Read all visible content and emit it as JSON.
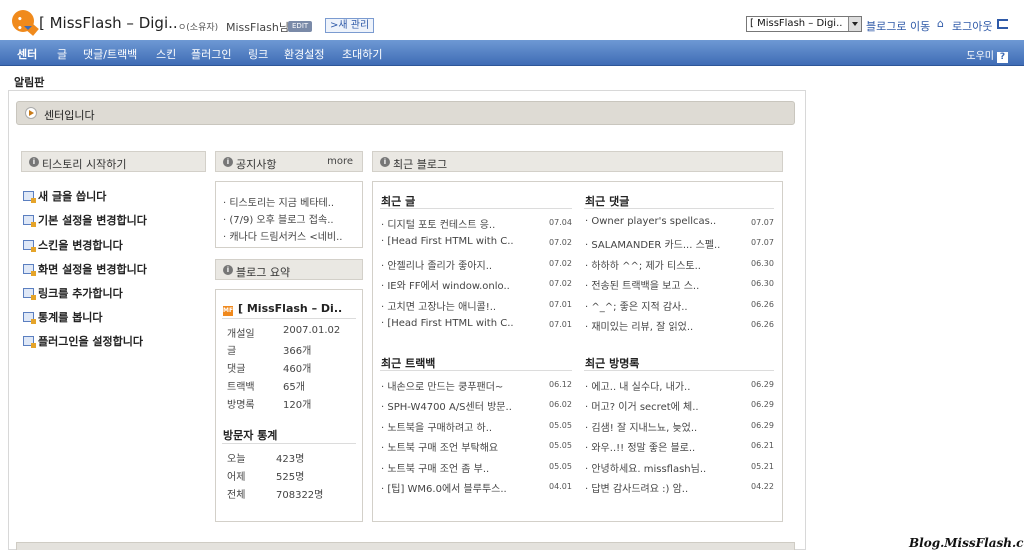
{
  "header": {
    "blog_title": "[ MissFlash – Digi..",
    "owner_label": "ㅇ(소유자)",
    "owner_name": "MissFlash님",
    "edit_badge": "EDIT",
    "new_admin": ">새 관리",
    "blog_select_value": "[ MissFlash – Digi..",
    "goto_blog": "블로그로 이동",
    "logout": "로그아웃"
  },
  "nav": {
    "items": [
      "센터",
      "글",
      "댓글/트랙백",
      "스킨",
      "플러그인",
      "링크",
      "환경설정",
      "초대하기"
    ],
    "help": "도우미"
  },
  "notice_label": "알림판",
  "center_message": "센터입니다",
  "start": {
    "title": "티스토리 시작하기",
    "items": [
      "새 글을 씁니다",
      "기본 설정을 변경합니다",
      "스킨을 변경합니다",
      "화면 설정을 변경합니다",
      "링크를 추가합니다",
      "통계를 봅니다",
      "플러그인을 설정합니다"
    ]
  },
  "notice": {
    "title": "공지사항",
    "more": "more",
    "items": [
      "티스토리는 지금 베타테..",
      "(7/9) 오후 블로그 접속..",
      "캐나다 드림서커스 <네비.."
    ]
  },
  "summary": {
    "title": "블로그 요약",
    "blog_name": "[ MissFlash – Di..",
    "rows": [
      {
        "label": "개설일",
        "value": "2007.01.02"
      },
      {
        "label": "글",
        "value": "366개"
      },
      {
        "label": "댓글",
        "value": "460개"
      },
      {
        "label": "트랙백",
        "value": "65개"
      },
      {
        "label": "방명록",
        "value": "120개"
      }
    ],
    "visitor_title": "방문자 통계",
    "visitor_rows": [
      {
        "label": "오늘",
        "value": "423명"
      },
      {
        "label": "어제",
        "value": "525명"
      },
      {
        "label": "전체",
        "value": "708322명"
      }
    ]
  },
  "recent": {
    "title": "최근 블로그",
    "posts": {
      "title": "최근 글",
      "items": [
        {
          "text": "디지털 포토 컨테스트 응..",
          "date": "07.04"
        },
        {
          "text": "[Head First HTML with C..",
          "date": "07.02"
        },
        {
          "text": "안젤리나 졸리가 좋아지..",
          "date": "07.02"
        },
        {
          "text": "IE와 FF에서 window.onlo..",
          "date": "07.02"
        },
        {
          "text": "고치면 고장나는 애니콜!..",
          "date": "07.01"
        },
        {
          "text": "[Head First HTML with C..",
          "date": "07.01"
        }
      ]
    },
    "comments": {
      "title": "최근 댓글",
      "items": [
        {
          "text": "Owner player's spellcas..",
          "date": "07.07"
        },
        {
          "text": "SALAMANDER 카드... 스펠..",
          "date": "07.07"
        },
        {
          "text": "하하하 ^^; 제가 티스토..",
          "date": "06.30"
        },
        {
          "text": "전송된 트랙백을 보고 스..",
          "date": "06.30"
        },
        {
          "text": "^_^; 좋은 지적 감사..",
          "date": "06.26"
        },
        {
          "text": "재미있는 리뷰, 잘 읽었..",
          "date": "06.26"
        }
      ]
    },
    "trackbacks": {
      "title": "최근 트랙백",
      "items": [
        {
          "text": "내손으로 만드는 쿵푸팬더~",
          "date": "06.12"
        },
        {
          "text": "SPH-W4700 A/S센터 방문..",
          "date": "06.02"
        },
        {
          "text": "노트북을 구매하려고 하..",
          "date": "05.05"
        },
        {
          "text": "노트북 구매 조언 부탁해요",
          "date": "05.05"
        },
        {
          "text": "노트북 구매 조언 좀 부..",
          "date": "05.05"
        },
        {
          "text": "[팁] WM6.0에서 블루투스..",
          "date": "04.01"
        }
      ]
    },
    "guestbook": {
      "title": "최근 방명록",
      "items": [
        {
          "text": "에고.. 내 실수다, 내가..",
          "date": "06.29"
        },
        {
          "text": "머고? 이거 secret에 체..",
          "date": "06.29"
        },
        {
          "text": "김샘! 잘 지내느뇨, 늦었..",
          "date": "06.29"
        },
        {
          "text": "와우..!! 정말 좋은 블로..",
          "date": "06.21"
        },
        {
          "text": "안녕하세요. missflash님..",
          "date": "05.21"
        },
        {
          "text": "답변 감사드려요 :) 암..",
          "date": "04.22"
        }
      ]
    }
  },
  "watermark": "Blog.MissFlash.com",
  "colors": {
    "nav_bg": "#4f7cc2",
    "accent_orange": "#f08a1c",
    "panel_head": "#eae8e3"
  }
}
